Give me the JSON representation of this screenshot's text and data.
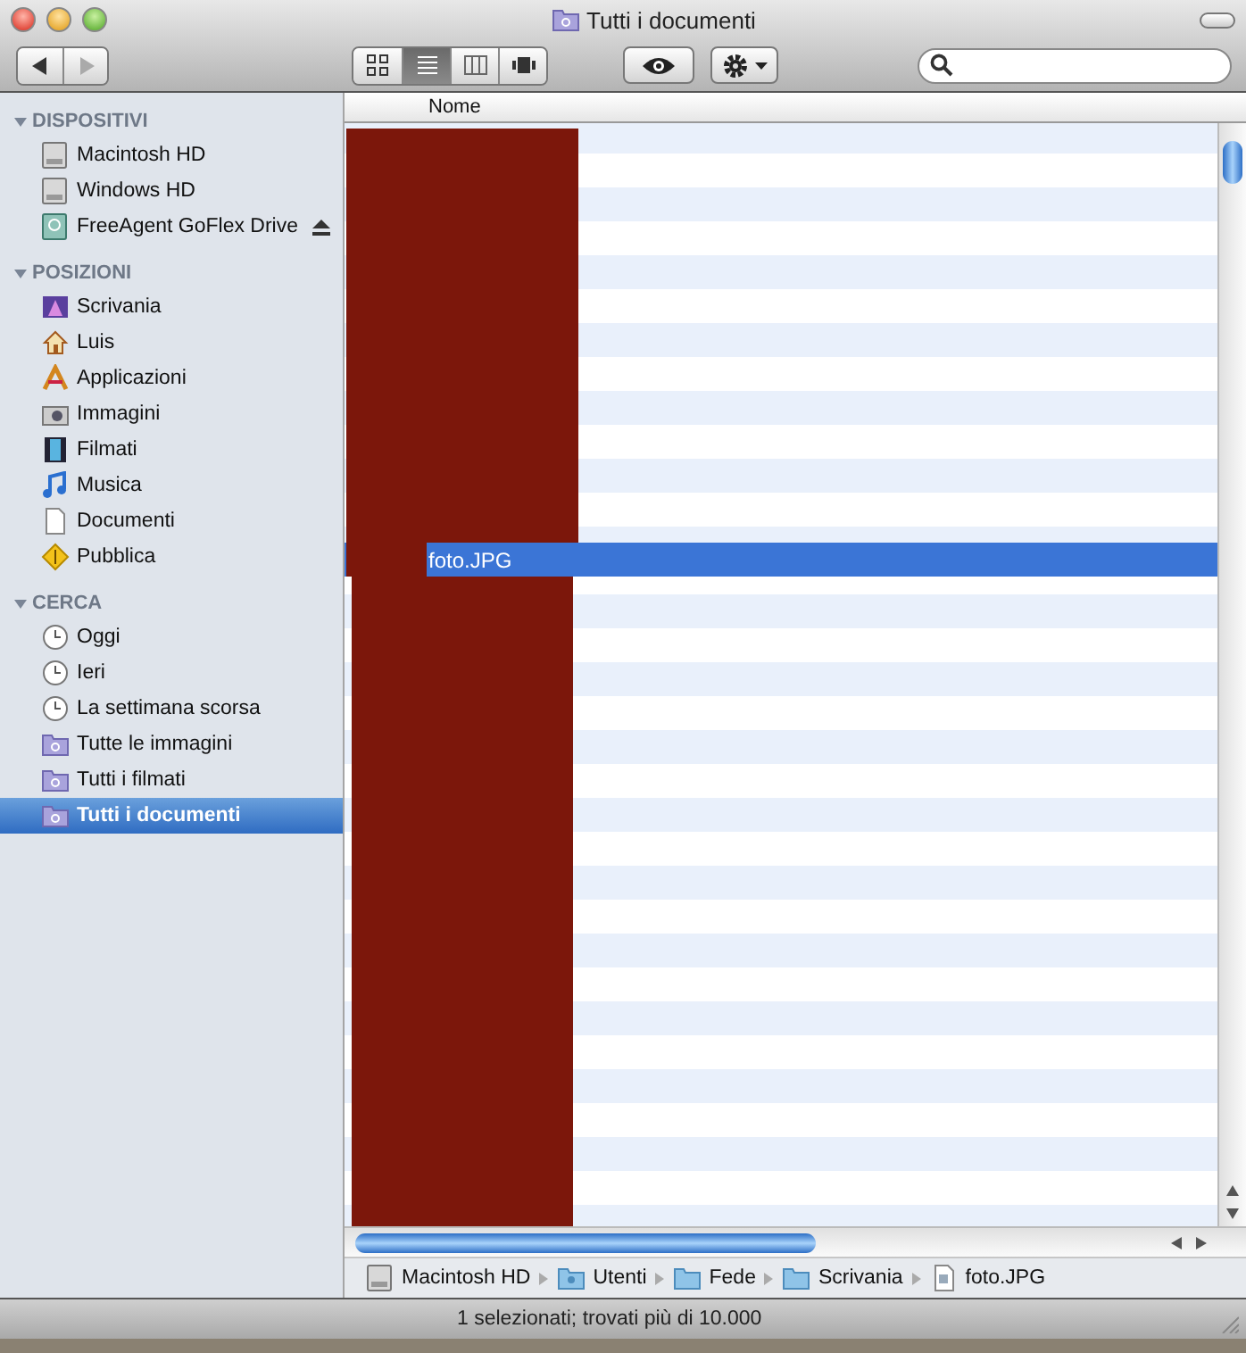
{
  "window": {
    "title": "Tutti i documenti"
  },
  "toolbar": {
    "views": [
      {
        "kind": "icons",
        "selected": false
      },
      {
        "kind": "list",
        "selected": true
      },
      {
        "kind": "columns",
        "selected": false
      },
      {
        "kind": "coverflow",
        "selected": false
      }
    ]
  },
  "sidebar": {
    "sections": [
      {
        "title": "DISPOSITIVI",
        "expanded": true,
        "items": [
          {
            "label": "Macintosh HD",
            "kind": "disk",
            "selected": false
          },
          {
            "label": "Windows HD",
            "kind": "disk",
            "selected": false
          },
          {
            "label": "FreeAgent GoFlex Drive",
            "kind": "external",
            "selected": false,
            "ejectable": true
          }
        ]
      },
      {
        "title": "POSIZIONI",
        "expanded": true,
        "items": [
          {
            "label": "Scrivania",
            "kind": "desktop",
            "selected": false
          },
          {
            "label": "Luis",
            "kind": "home",
            "selected": false
          },
          {
            "label": "Applicazioni",
            "kind": "apps",
            "selected": false
          },
          {
            "label": "Immagini",
            "kind": "pictures",
            "selected": false
          },
          {
            "label": "Filmati",
            "kind": "movies",
            "selected": false
          },
          {
            "label": "Musica",
            "kind": "music",
            "selected": false
          },
          {
            "label": "Documenti",
            "kind": "document",
            "selected": false
          },
          {
            "label": "Pubblica",
            "kind": "public",
            "selected": false
          }
        ]
      },
      {
        "title": "CERCA",
        "expanded": true,
        "items": [
          {
            "label": "Oggi",
            "kind": "clock",
            "selected": false
          },
          {
            "label": "Ieri",
            "kind": "clock",
            "selected": false
          },
          {
            "label": "La settimana scorsa",
            "kind": "clock",
            "selected": false
          },
          {
            "label": "Tutte le immagini",
            "kind": "smartfolder",
            "selected": false
          },
          {
            "label": "Tutti i filmati",
            "kind": "smartfolder",
            "selected": false
          },
          {
            "label": "Tutti i documenti",
            "kind": "smartfolder",
            "selected": true
          }
        ]
      }
    ]
  },
  "file_list": {
    "columns": [
      "Nome"
    ],
    "rows": [
      {
        "name": "foto.JPG",
        "selected": true
      }
    ]
  },
  "path_bar": [
    {
      "label": "Macintosh HD",
      "kind": "disk"
    },
    {
      "label": "Utenti",
      "kind": "users"
    },
    {
      "label": "Fede",
      "kind": "folder"
    },
    {
      "label": "Scrivania",
      "kind": "folder"
    },
    {
      "label": "foto.JPG",
      "kind": "file"
    }
  ],
  "status_bar": "1 selezionati; trovati più di 10.000"
}
